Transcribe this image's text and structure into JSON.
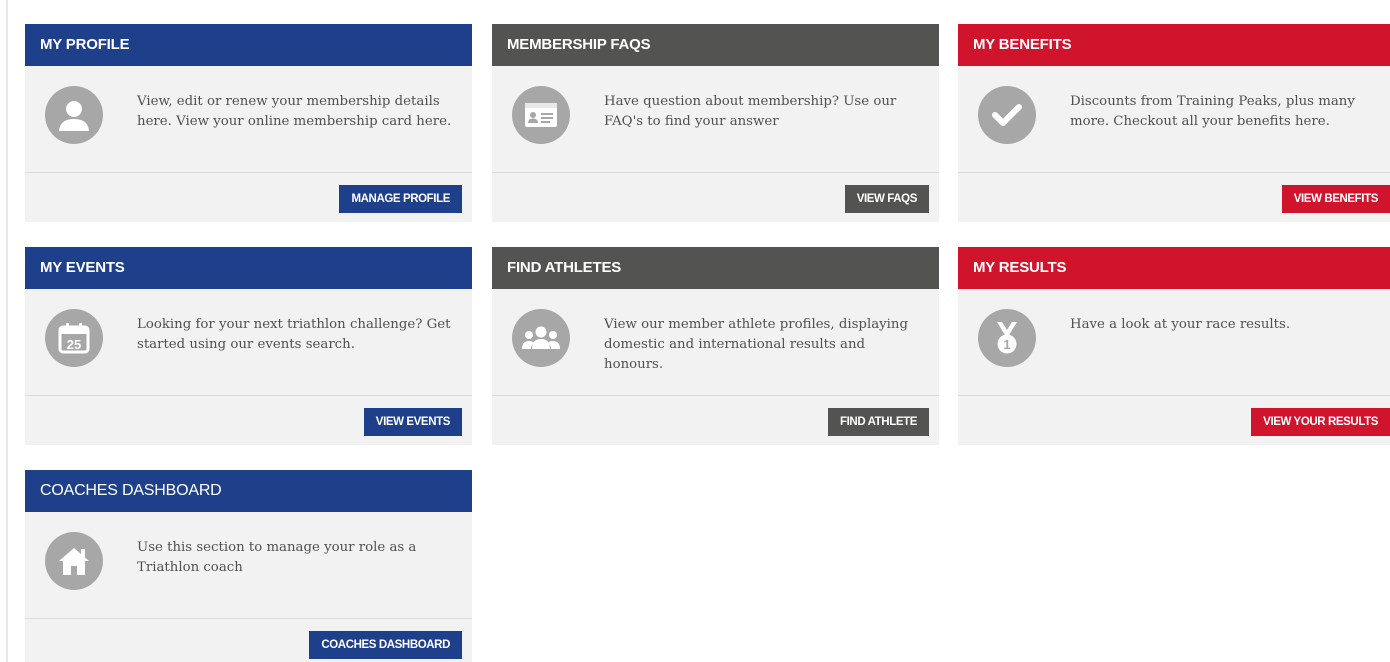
{
  "cards": [
    {
      "title": "MY PROFILE",
      "text": "View, edit or renew your membership details here. View your online membership card here.",
      "button": "MANAGE PROFILE",
      "icon": "user-icon",
      "color": "#1e3f89"
    },
    {
      "title": "MEMBERSHIP FAQS",
      "text": "Have question about membership? Use our FAQ's to find your answer",
      "button": "VIEW FAQS",
      "icon": "id-card-icon",
      "color": "#535351"
    },
    {
      "title": "MY BENEFITS",
      "text": "Discounts from Training Peaks, plus many more. Checkout all your benefits here.",
      "button": "VIEW BENEFITS",
      "icon": "checkmark-icon",
      "color": "#d0142c"
    },
    {
      "title": "MY EVENTS",
      "text": "Looking for your next triathlon challenge? Get started using our events search.",
      "button": "VIEW EVENTS",
      "icon": "calendar-icon",
      "icon_label": "25",
      "color": "#1e3f89"
    },
    {
      "title": "FIND ATHLETES",
      "text": "View our member athlete profiles, displaying domestic and international results and honours.",
      "button": "FIND ATHLETE",
      "icon": "group-icon",
      "color": "#535351"
    },
    {
      "title": "MY RESULTS",
      "text": "Have a look at your race results.",
      "button": "VIEW YOUR RESULTS",
      "icon": "medal-icon",
      "icon_label": "1",
      "color": "#d0142c"
    },
    {
      "title": "COACHES DASHBOARD",
      "text": "Use this section to manage your role as a Triathlon coach",
      "button": "COACHES DASHBOARD",
      "icon": "home-icon",
      "color": "#1e3f89"
    }
  ]
}
